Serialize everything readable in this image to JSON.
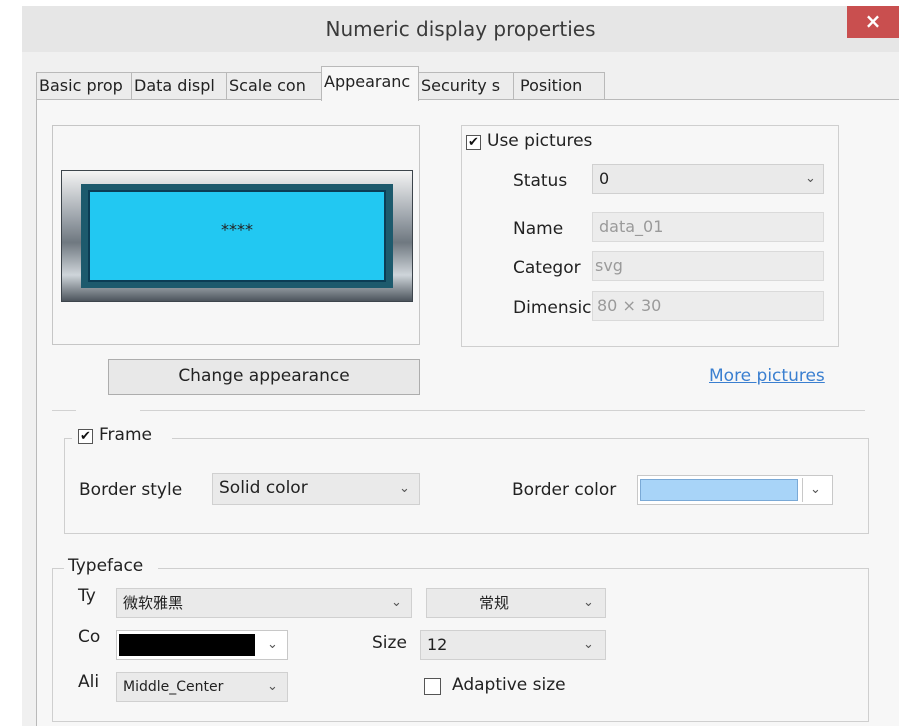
{
  "window": {
    "title": "Numeric display properties",
    "close_glyph": "×"
  },
  "tabs": [
    {
      "label": "Basic prop"
    },
    {
      "label": "Data displ"
    },
    {
      "label": "Scale con"
    },
    {
      "label": "Appearanc"
    },
    {
      "label": "Security s"
    },
    {
      "label": "Position"
    }
  ],
  "preview": {
    "text": "****",
    "screen_color": "#22c8f2"
  },
  "use_pictures": {
    "label": "Use pictures",
    "checked": true,
    "status_label": "Status",
    "status_value": "0",
    "name_label": "Name",
    "name_value": "data_01",
    "category_label": "Categor",
    "category_value": "svg",
    "dimension_label": "Dimensic",
    "dimension_value": "80 × 30"
  },
  "buttons": {
    "change_appearance": "Change appearance",
    "more_pictures": "More pictures"
  },
  "frame": {
    "label": "Frame",
    "checked": true,
    "border_style_label": "Border style",
    "border_style_value": "Solid color",
    "border_color_label": "Border color",
    "border_color_value": "#a8d4f8"
  },
  "typeface": {
    "legend": "Typeface",
    "type_label": "Ty",
    "type_value": "微软雅黑",
    "style_value": "常规",
    "color_label": "Co",
    "color_value": "#000000",
    "size_label": "Size",
    "size_value": "12",
    "align_label": "Ali",
    "align_value": "Middle_Center",
    "adaptive_label": "Adaptive size",
    "adaptive_checked": false
  },
  "icons": {
    "dropdown": "⌄",
    "check": "✔"
  }
}
